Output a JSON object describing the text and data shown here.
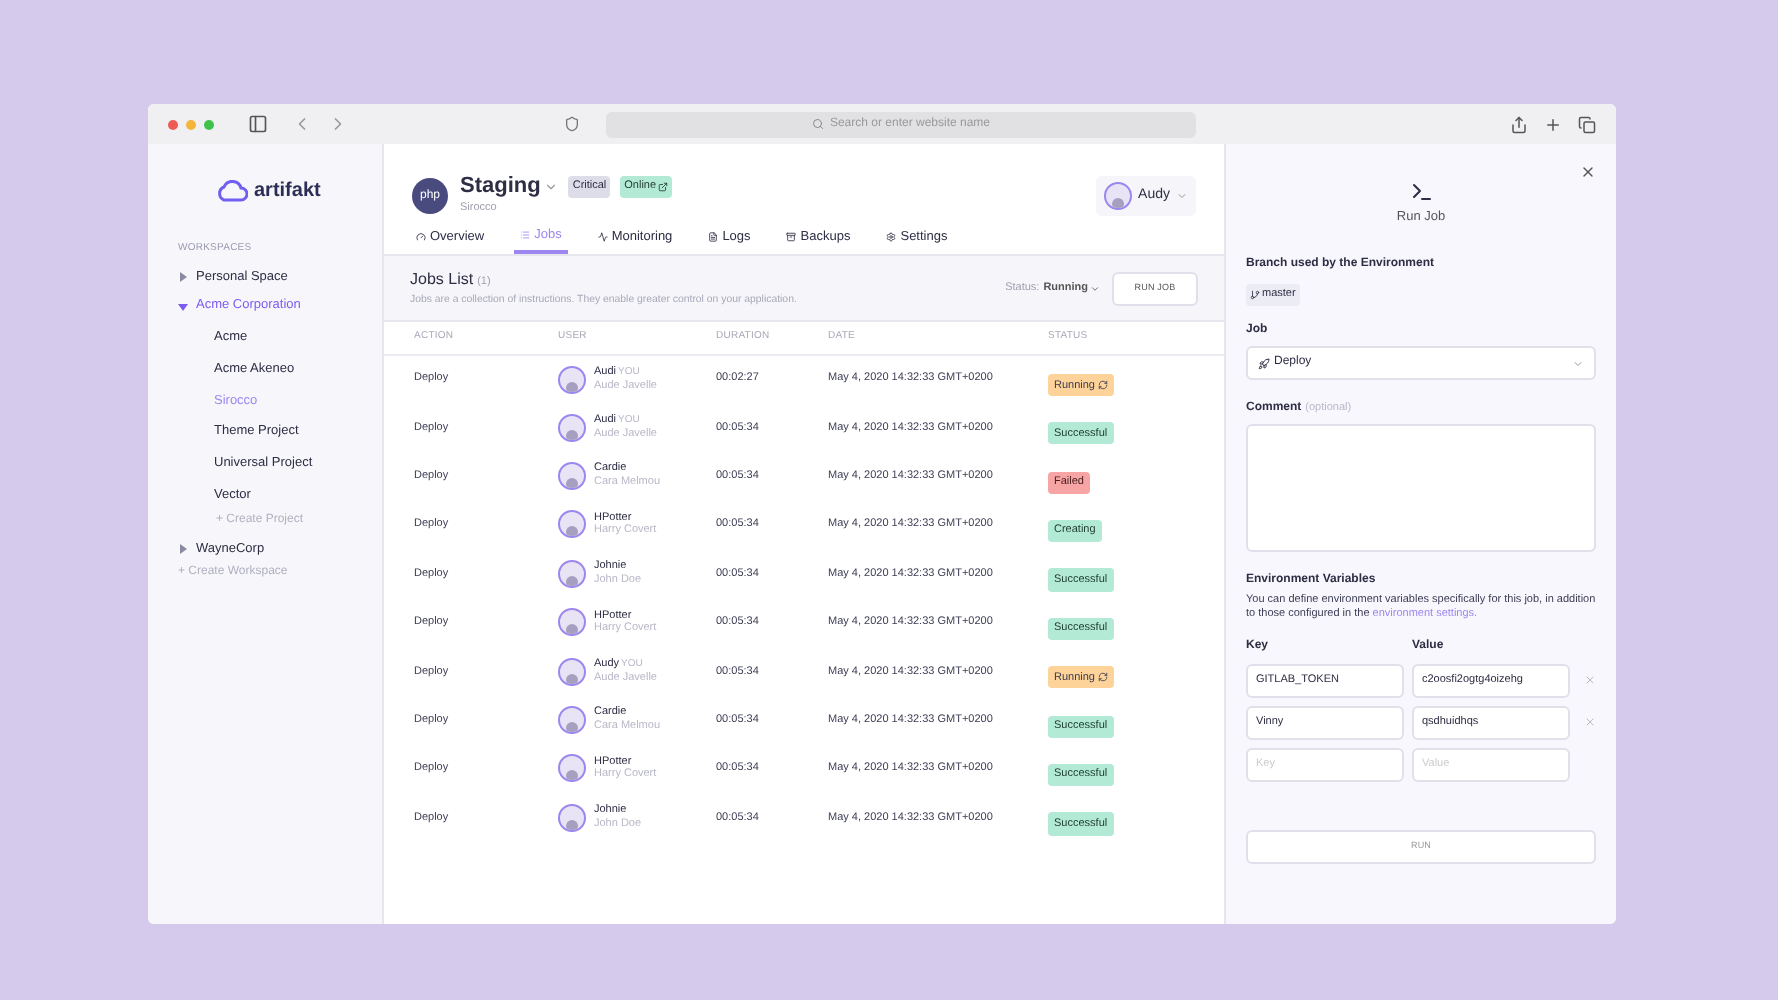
{
  "browser": {
    "address_placeholder": "Search or enter website name"
  },
  "sidebar": {
    "logo": "artifakt",
    "section": "WORKSPACES",
    "workspaces": [
      {
        "label": "Personal Space",
        "expanded": false,
        "selected": false
      },
      {
        "label": "Acme Corporation",
        "expanded": true,
        "selected": true,
        "children": [
          {
            "label": "Acme",
            "selected": false
          },
          {
            "label": "Acme Akeneo",
            "selected": false
          },
          {
            "label": "Sirocco",
            "selected": true
          },
          {
            "label": "Theme Project",
            "selected": false
          },
          {
            "label": "Universal Project",
            "selected": false
          },
          {
            "label": "Vector",
            "selected": false
          }
        ],
        "create_project": "+ Create Project"
      },
      {
        "label": "WayneCorp",
        "expanded": false,
        "selected": false
      }
    ],
    "create_workspace": "+ Create Workspace"
  },
  "header": {
    "project_logo": "php",
    "title": "Staging",
    "subtitle": "Sirocco",
    "badges": [
      {
        "label": "Critical",
        "kind": "critical"
      },
      {
        "label": "Online",
        "kind": "online"
      }
    ],
    "user": "Audy"
  },
  "tabs": [
    {
      "label": "Overview",
      "selected": false
    },
    {
      "label": "Jobs",
      "selected": true
    },
    {
      "label": "Monitoring",
      "selected": false
    },
    {
      "label": "Logs",
      "selected": false
    },
    {
      "label": "Backups",
      "selected": false
    },
    {
      "label": "Settings",
      "selected": false
    }
  ],
  "jobs": {
    "title": "Jobs List",
    "count": "(1)",
    "description": "Jobs are a collection of instructions. They enable greater control on your application.",
    "status_label": "Status:",
    "status_value": "Running",
    "button": "RUN JOB"
  },
  "table": {
    "columns": [
      "ACTION",
      "USER",
      "DURATION",
      "DATE",
      "STATUS"
    ],
    "rows": [
      {
        "action": "Deploy",
        "user": "Audi",
        "you": "YOU",
        "full_name": "Aude Javelle",
        "duration": "00:02:27",
        "date": "May 4, 2020 14:32:33 GMT+0200",
        "status": {
          "label": "Running",
          "kind": "running"
        }
      },
      {
        "action": "Deploy",
        "user": "Audi",
        "you": "YOU",
        "full_name": "Aude Javelle",
        "duration": "00:05:34",
        "date": "May 4, 2020 14:32:33 GMT+0200",
        "status": {
          "label": "Successful",
          "kind": "success"
        }
      },
      {
        "action": "Deploy",
        "user": "Cardie",
        "full_name": "Cara Melmou",
        "duration": "00:05:34",
        "date": "May 4, 2020 14:32:33 GMT+0200",
        "status": {
          "label": "Failed",
          "kind": "failed"
        }
      },
      {
        "action": "Deploy",
        "user": "HPotter",
        "full_name": "Harry Covert",
        "duration": "00:05:34",
        "date": "May 4, 2020 14:32:33 GMT+0200",
        "status": {
          "label": "Creating",
          "kind": "creating"
        }
      },
      {
        "action": "Deploy",
        "user": "Johnie",
        "full_name": "John Doe",
        "duration": "00:05:34",
        "date": "May 4, 2020 14:32:33 GMT+0200",
        "status": {
          "label": "Successful",
          "kind": "success"
        }
      },
      {
        "action": "Deploy",
        "user": "HPotter",
        "full_name": "Harry Covert",
        "duration": "00:05:34",
        "date": "May 4, 2020 14:32:33 GMT+0200",
        "status": {
          "label": "Successful",
          "kind": "success"
        }
      },
      {
        "action": "Deploy",
        "user": "Audy",
        "you": "YOU",
        "full_name": "Aude Javelle",
        "duration": "00:05:34",
        "date": "May 4, 2020 14:32:33 GMT+0200",
        "status": {
          "label": "Running",
          "kind": "running"
        }
      },
      {
        "action": "Deploy",
        "user": "Cardie",
        "full_name": "Cara Melmou",
        "duration": "00:05:34",
        "date": "May 4, 2020 14:32:33 GMT+0200",
        "status": {
          "label": "Successful",
          "kind": "success"
        }
      },
      {
        "action": "Deploy",
        "user": "HPotter",
        "full_name": "Harry Covert",
        "duration": "00:05:34",
        "date": "May 4, 2020 14:32:33 GMT+0200",
        "status": {
          "label": "Successful",
          "kind": "success"
        }
      },
      {
        "action": "Deploy",
        "user": "Johnie",
        "full_name": "John Doe",
        "duration": "00:05:34",
        "date": "May 4, 2020 14:32:33 GMT+0200",
        "status": {
          "label": "Successful",
          "kind": "success"
        }
      }
    ]
  },
  "panel": {
    "title": "Run Job",
    "branch_label": "Branch used by the Environment",
    "branch": "master",
    "job_label": "Job",
    "job_value": "Deploy",
    "comment_label": "Comment",
    "comment_hint": "(optional)",
    "env_title": "Environment Variables",
    "env_text": "You can define environment variables specifically for this job, in addition to those configured in the",
    "env_link": "environment settings.",
    "key_label": "Key",
    "value_label": "Value",
    "variables": [
      {
        "key": "GITLAB_TOKEN",
        "value": "c2oosfi2ogtg4oizehg"
      },
      {
        "key": "Vinny",
        "value": "qsdhuidhqs"
      }
    ],
    "key_placeholder": "Key",
    "value_placeholder": "Value",
    "run_button": "RUN"
  }
}
